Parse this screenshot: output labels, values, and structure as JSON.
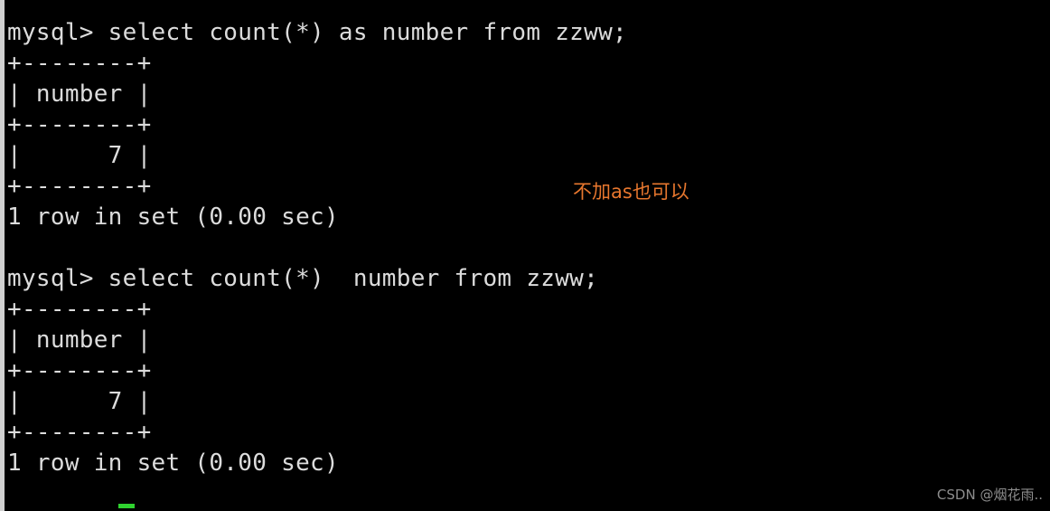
{
  "terminal": {
    "colors": {
      "background": "#000000",
      "foreground": "#dcdcdc",
      "annotation": "#e8772e",
      "watermark": "#8d8d8d",
      "cursor": "#2fd22f",
      "window_border": "#d0d0d0"
    },
    "prompt": "mysql>",
    "lines": [
      "mysql> select count(*) as number from zzww;",
      "+--------+",
      "| number |",
      "+--------+",
      "|      7 |",
      "+--------+",
      "1 row in set (0.00 sec)",
      "",
      "mysql> select count(*)  number from zzww;",
      "+--------+",
      "| number |",
      "+--------+",
      "|      7 |",
      "+--------+",
      "1 row in set (0.00 sec)"
    ],
    "text": "mysql> select count(*) as number from zzww;\n+--------+\n| number |\n+--------+\n|      7 |\n+--------+\n1 row in set (0.00 sec)\n\nmysql> select count(*)  number from zzww;\n+--------+\n| number |\n+--------+\n|      7 |\n+--------+\n1 row in set (0.00 sec)",
    "queries": [
      {
        "command": "select count(*) as number from zzww;",
        "column_header": "number",
        "value": "7",
        "status": "1 row in set (0.00 sec)"
      },
      {
        "command": "select count(*)  number from zzww;",
        "column_header": "number",
        "value": "7",
        "status": "1 row in set (0.00 sec)"
      }
    ]
  },
  "annotation": {
    "text": "不加as也可以"
  },
  "watermark": {
    "text": "CSDN @烟花雨.."
  }
}
